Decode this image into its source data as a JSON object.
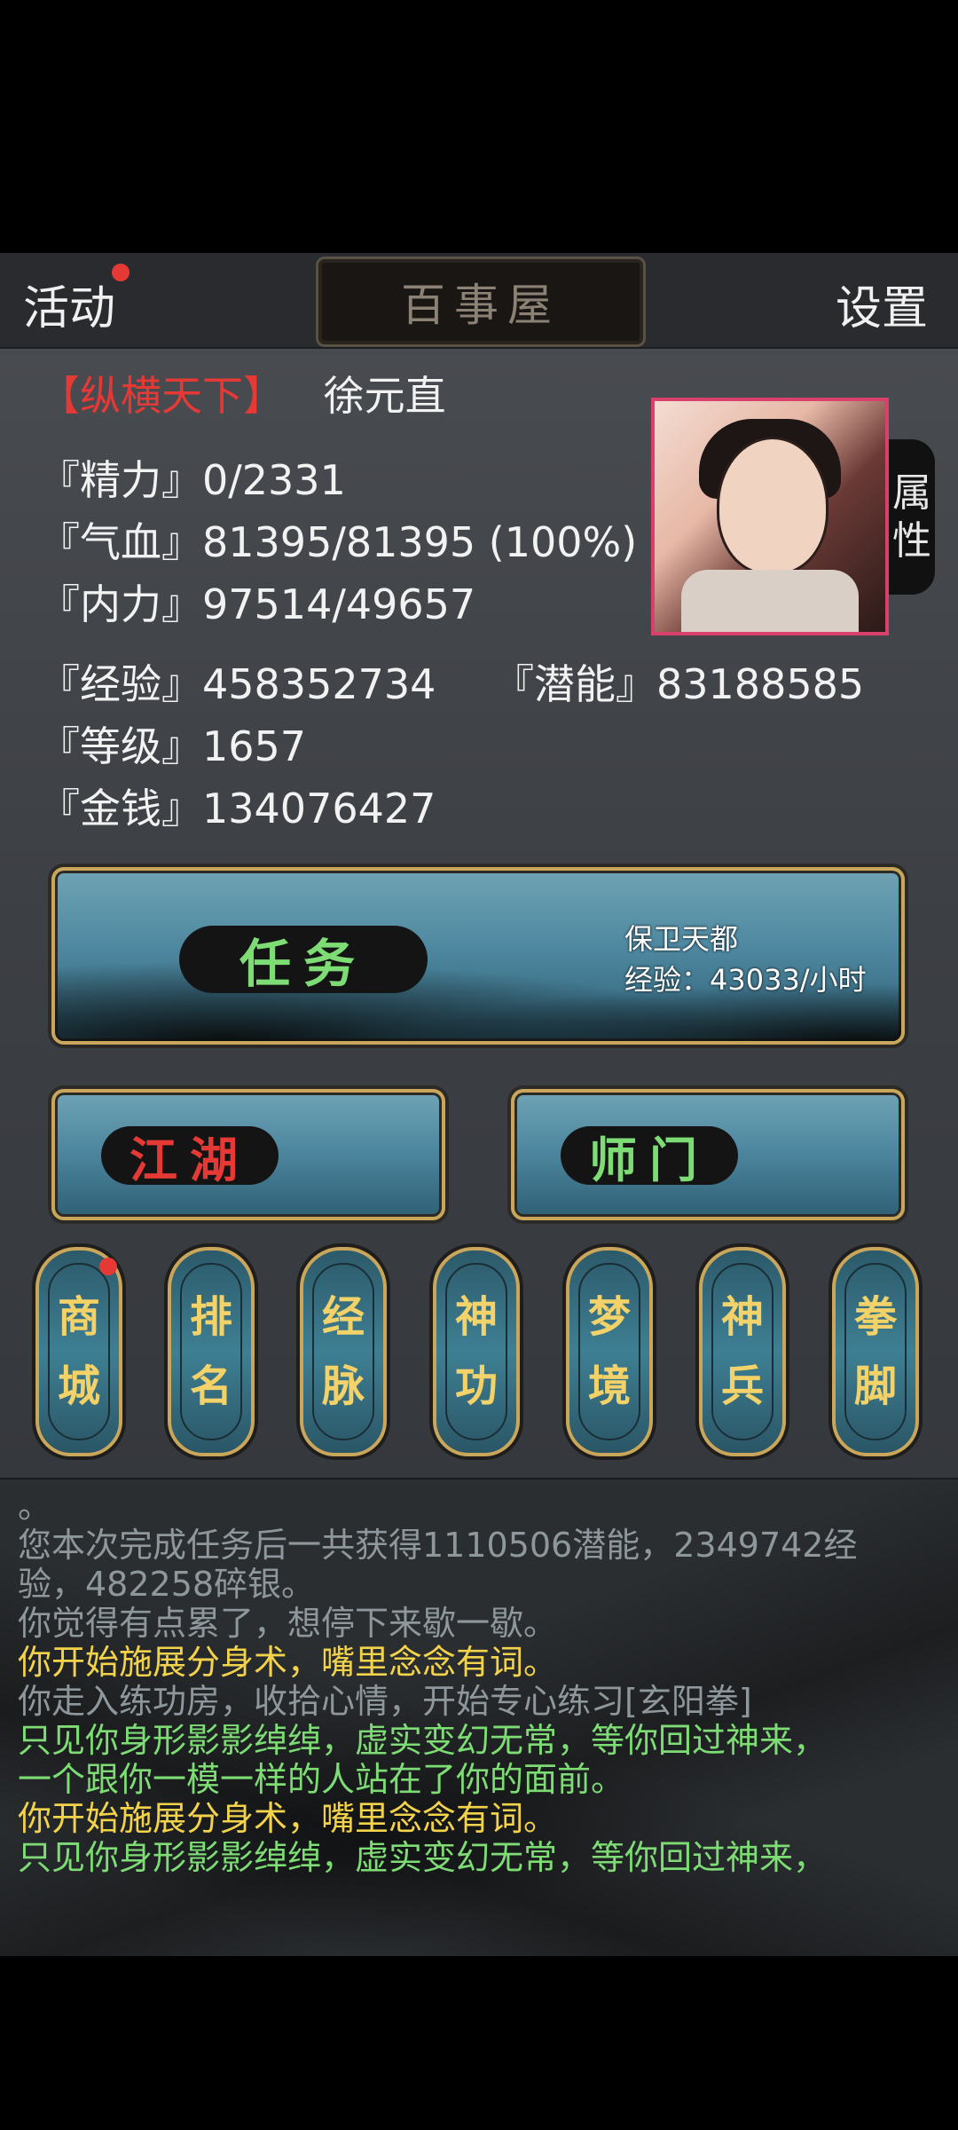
{
  "topbar": {
    "left_label": "活动",
    "title": "百事屋",
    "right_label": "设置"
  },
  "player": {
    "sect_tag": "【纵横天下】",
    "name": "徐元直",
    "attr_tab": [
      "属",
      "性"
    ],
    "stats": {
      "jingli": "『精力』0/2331",
      "qixue": "『气血』81395/81395 (100%)",
      "neili": "『内力』97514/49657",
      "jingyan": "『经验』458352734",
      "qianneng": "『潜能』83188585",
      "dengji": "『等级』1657",
      "jinqian": "『金钱』134076427"
    }
  },
  "task_banner": {
    "label": "任务",
    "info_title": "保卫天都",
    "info_rate": "经验：43033/小时"
  },
  "jianghu_button": {
    "label": "江湖",
    "color": "#e53935"
  },
  "shimen_button": {
    "label": "师门",
    "color": "#7ddc74"
  },
  "menu": [
    {
      "top": "商",
      "bottom": "城",
      "badge": true
    },
    {
      "top": "排",
      "bottom": "名",
      "badge": false
    },
    {
      "top": "经",
      "bottom": "脉",
      "badge": false
    },
    {
      "top": "神",
      "bottom": "功",
      "badge": false
    },
    {
      "top": "梦",
      "bottom": "境",
      "badge": false
    },
    {
      "top": "神",
      "bottom": "兵",
      "badge": false
    },
    {
      "top": "拳",
      "bottom": "脚",
      "badge": false
    }
  ],
  "log": {
    "lines": [
      {
        "text": "。",
        "color": "gray"
      },
      {
        "text": "您本次完成任务后一共获得1110506潜能，2349742经",
        "color": "gray"
      },
      {
        "text": "验，482258碎银。",
        "color": "gray"
      },
      {
        "text": "你觉得有点累了，想停下来歇一歇。",
        "color": "gray"
      },
      {
        "text": "你开始施展分身术，嘴里念念有词。",
        "color": "yellow"
      },
      {
        "text": "你走入练功房，收拾心情，开始专心练习[玄阳拳]",
        "color": "gray"
      },
      {
        "text": "只见你身形影影绰绰，虚实变幻无常，等你回过神来，",
        "color": "green"
      },
      {
        "text": "一个跟你一模一样的人站在了你的面前。",
        "color": "green"
      },
      {
        "text": "你开始施展分身术，嘴里念念有词。",
        "color": "yellow"
      },
      {
        "text": "只见你身形影影绰绰，虚实变幻无常，等你回过神来，",
        "color": "green"
      }
    ]
  }
}
